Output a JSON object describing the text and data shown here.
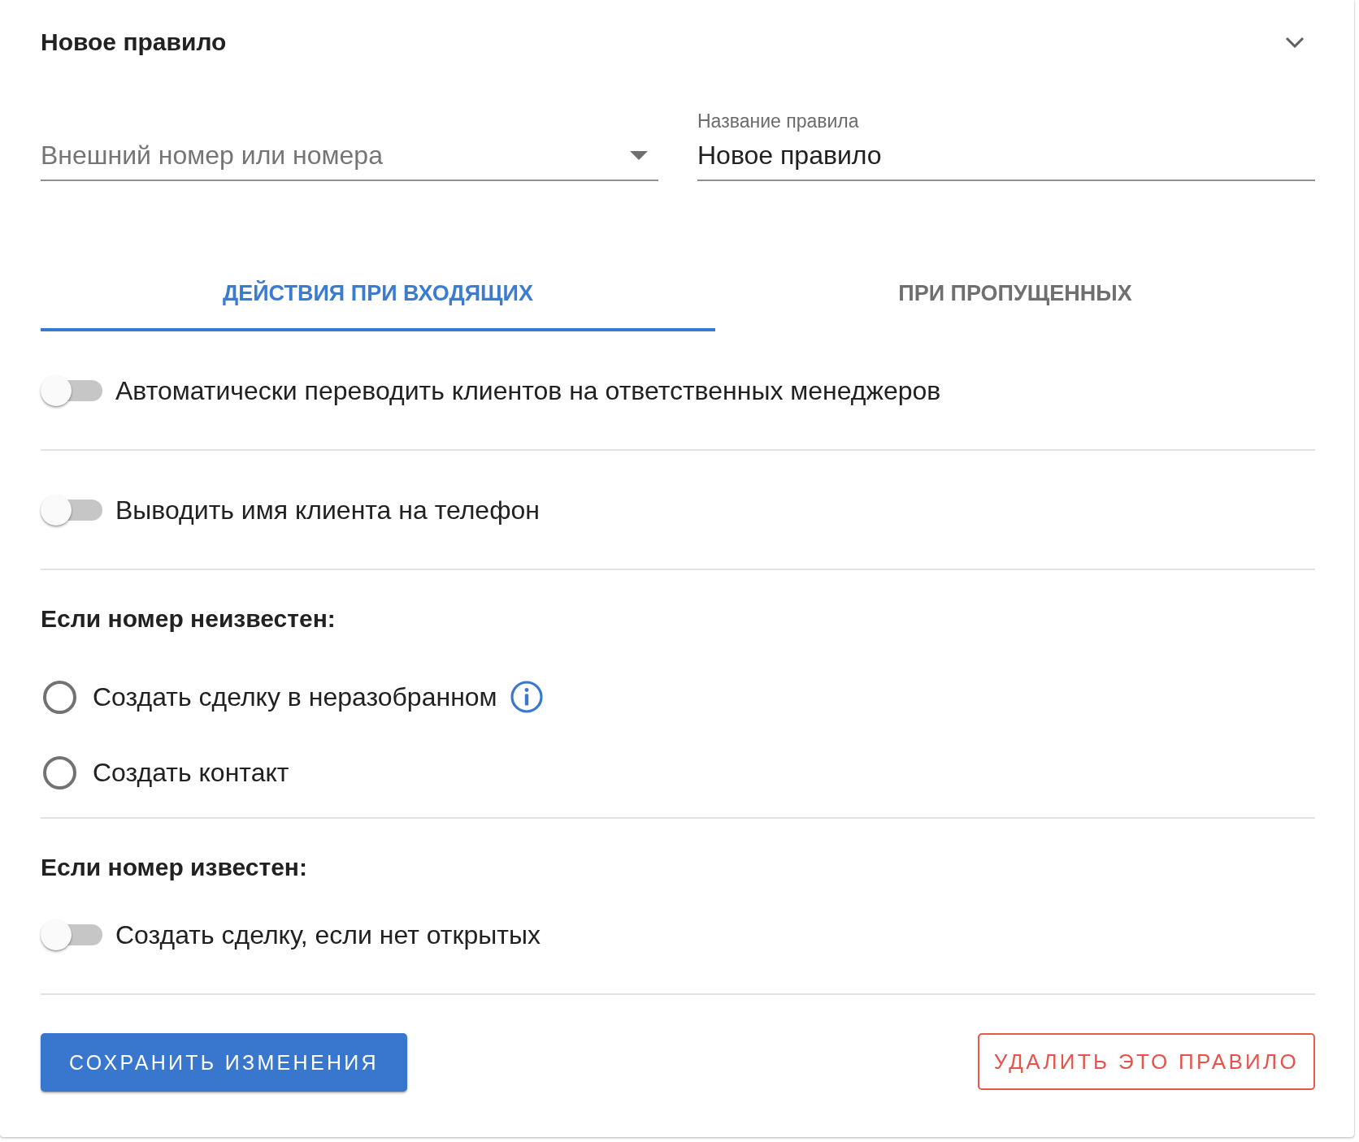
{
  "panel": {
    "title": "Новое правило",
    "expanded": true
  },
  "fields": [
    {
      "kind": "select",
      "placeholder": "Внешний номер или номера"
    },
    {
      "kind": "text",
      "label": "Название правила",
      "value": "Новое правило"
    }
  ],
  "tabs": [
    {
      "label": "ДЕЙСТВИЯ ПРИ ВХОДЯЩИХ",
      "selected": true
    },
    {
      "label": "ПРИ ПРОПУЩЕННЫХ",
      "selected": false
    }
  ],
  "groups": [
    {
      "options": [
        {
          "kind": "toggle",
          "label": "Автоматически переводить клиентов на ответственных менеджеров",
          "on": false
        }
      ]
    },
    {
      "options": [
        {
          "kind": "toggle",
          "label": "Выводить имя клиента на телефон",
          "on": false
        }
      ]
    },
    {
      "heading": "Если номер неизвестен:",
      "options": [
        {
          "kind": "radio",
          "label": "Создать сделку в неразобранном",
          "selected": false,
          "info": true
        },
        {
          "kind": "radio",
          "label": "Создать контакт",
          "selected": false,
          "info": false
        }
      ]
    },
    {
      "heading": "Если номер известен:",
      "options": [
        {
          "kind": "toggle",
          "label": "Создать сделку, если нет открытых",
          "on": false
        }
      ]
    }
  ],
  "buttons": [
    {
      "kind": "primary",
      "label": "СОХРАНИТЬ ИЗМЕНЕНИЯ"
    },
    {
      "kind": "danger",
      "label": "УДАЛИТЬ ЭТО ПРАВИЛО"
    }
  ]
}
